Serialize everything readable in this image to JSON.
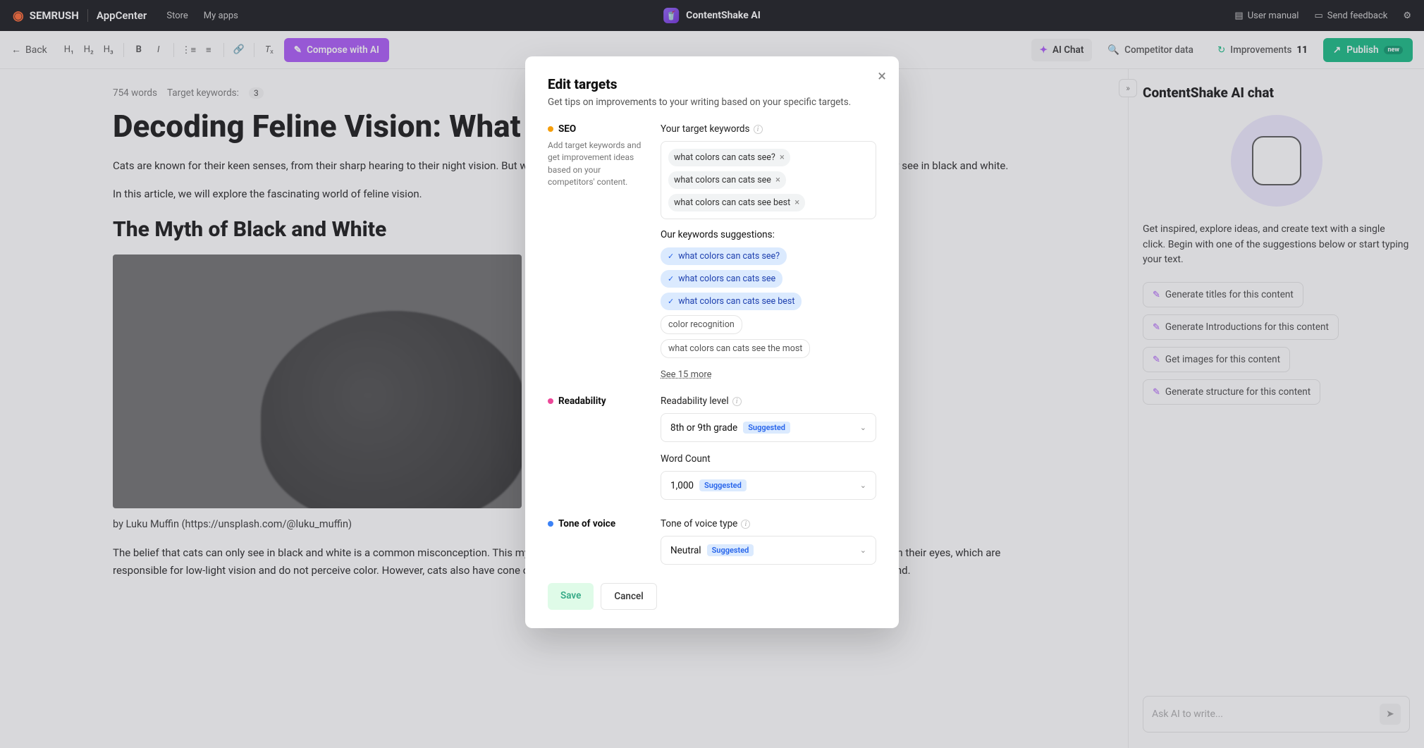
{
  "topbar": {
    "brand": "SEMRUSH",
    "appcenter": "AppCenter",
    "store": "Store",
    "my_apps": "My apps",
    "app_name": "ContentShake AI",
    "user_manual": "User manual",
    "send_feedback": "Send feedback"
  },
  "toolbar": {
    "back": "Back",
    "compose": "Compose with AI",
    "ai_chat": "AI Chat",
    "competitor": "Competitor data",
    "improvements": "Improvements",
    "improvements_count": "11",
    "publish": "Publish",
    "new_badge": "new"
  },
  "editor": {
    "word_count": "754 words",
    "target_kw_label": "Target keywords:",
    "kw_count": "3",
    "title": "Decoding Feline Vision: What are Cat Colors?",
    "para1": "Cats are known for their keen senses, from their sharp hearing to their night vision. But what about the colors they see? It is a common misconception that cats can only see in black and white.",
    "para2": "In this article, we will explore the fascinating world of feline vision.",
    "subhead": "The Myth of Black and White",
    "caption": "by Luku Muffin (https://unsplash.com/@luku_muffin)",
    "para3": "The belief that cats can only see in black and white is a common misconception. This myth likely stems from the fact that cats have a higher concentration of rod cells in their eyes, which are responsible for low-light vision and do not perceive color. However, cats also have cone cells, which are responsible for color vision, and they are not completely colorblind."
  },
  "chat": {
    "title": "ContentShake AI chat",
    "intro": "Get inspired, explore ideas, and create text with a single click. Begin with one of the suggestions below or start typing your text.",
    "sugg1": "Generate titles for this content",
    "sugg2": "Generate Introductions for this content",
    "sugg3": "Get images for this content",
    "sugg4": "Generate structure for this content",
    "placeholder": "Ask AI to write..."
  },
  "modal": {
    "title": "Edit targets",
    "subtitle": "Get tips on improvements to your writing based on your specific targets.",
    "seo": {
      "label": "SEO",
      "desc": "Add target keywords and get improvement ideas based on your competitors' content.",
      "kw_label": "Your target keywords",
      "tags": [
        "what colors can cats see?",
        "what colors can cats see",
        "what colors can cats see best"
      ],
      "sugg_label": "Our keywords suggestions:",
      "suggestions": [
        {
          "text": "what colors can cats see?",
          "selected": true
        },
        {
          "text": "what colors can cats see",
          "selected": true
        },
        {
          "text": "what colors can cats see best",
          "selected": true
        },
        {
          "text": "color recognition",
          "selected": false
        },
        {
          "text": "what colors can cats see the most",
          "selected": false
        }
      ],
      "see_more": "See 15 more"
    },
    "readability": {
      "label": "Readability",
      "level_label": "Readability level",
      "level_value": "8th or 9th grade",
      "wc_label": "Word Count",
      "wc_value": "1,000"
    },
    "tone": {
      "label": "Tone of voice",
      "type_label": "Tone of voice type",
      "value": "Neutral"
    },
    "suggested": "Suggested",
    "save": "Save",
    "cancel": "Cancel"
  }
}
